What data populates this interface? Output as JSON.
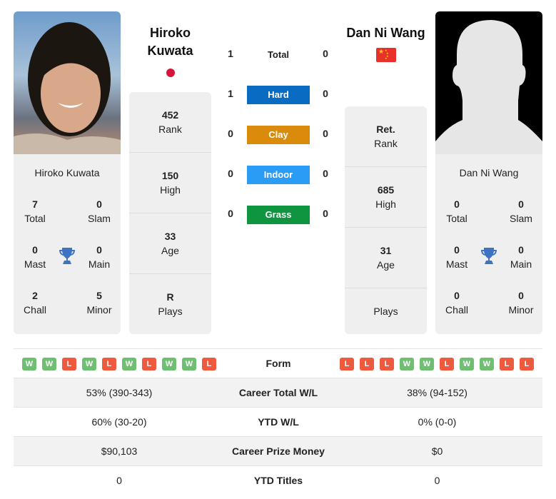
{
  "colors": {
    "hard": "#0a6bc2",
    "clay": "#db8b0b",
    "indoor": "#2a9cf6",
    "grass": "#0f9440",
    "win": "#6fbf73",
    "loss": "#ef5a3f",
    "trophy": "#3d73c0"
  },
  "player1": {
    "name_line1": "Hiroko",
    "name_line2": "Kuwata",
    "full_name": "Hiroko Kuwata",
    "flag": "japan-flag",
    "titles": {
      "total": {
        "value": "7",
        "label": "Total"
      },
      "slam": {
        "value": "0",
        "label": "Slam"
      },
      "mast": {
        "value": "0",
        "label": "Mast"
      },
      "main": {
        "value": "0",
        "label": "Main"
      },
      "chall": {
        "value": "2",
        "label": "Chall"
      },
      "minor": {
        "value": "5",
        "label": "Minor"
      }
    },
    "stats": [
      {
        "value": "452",
        "label": "Rank"
      },
      {
        "value": "150",
        "label": "High"
      },
      {
        "value": "33",
        "label": "Age"
      },
      {
        "value": "R",
        "label": "Plays"
      }
    ],
    "form": [
      "W",
      "W",
      "L",
      "W",
      "L",
      "W",
      "L",
      "W",
      "W",
      "L"
    ]
  },
  "player2": {
    "name": "Dan Ni Wang",
    "full_name": "Dan Ni Wang",
    "flag": "china-flag",
    "titles": {
      "total": {
        "value": "0",
        "label": "Total"
      },
      "slam": {
        "value": "0",
        "label": "Slam"
      },
      "mast": {
        "value": "0",
        "label": "Mast"
      },
      "main": {
        "value": "0",
        "label": "Main"
      },
      "chall": {
        "value": "0",
        "label": "Chall"
      },
      "minor": {
        "value": "0",
        "label": "Minor"
      }
    },
    "stats": [
      {
        "value": "Ret.",
        "label": "Rank"
      },
      {
        "value": "685",
        "label": "High"
      },
      {
        "value": "31",
        "label": "Age"
      },
      {
        "value": "",
        "label": "Plays"
      }
    ],
    "form": [
      "L",
      "L",
      "L",
      "W",
      "W",
      "L",
      "W",
      "W",
      "L",
      "L"
    ]
  },
  "h2h": [
    {
      "label": "Total",
      "p1": "1",
      "p2": "0"
    },
    {
      "label": "Hard",
      "p1": "1",
      "p2": "0"
    },
    {
      "label": "Clay",
      "p1": "0",
      "p2": "0"
    },
    {
      "label": "Indoor",
      "p1": "0",
      "p2": "0"
    },
    {
      "label": "Grass",
      "p1": "0",
      "p2": "0"
    }
  ],
  "table": {
    "form_label": "Form",
    "rows": [
      {
        "p1": "53% (390-343)",
        "label": "Career Total W/L",
        "p2": "38% (94-152)"
      },
      {
        "p1": "60% (30-20)",
        "label": "YTD W/L",
        "p2": "0% (0-0)"
      },
      {
        "p1": "$90,103",
        "label": "Career Prize Money",
        "p2": "$0"
      },
      {
        "p1": "0",
        "label": "YTD Titles",
        "p2": "0"
      }
    ]
  }
}
